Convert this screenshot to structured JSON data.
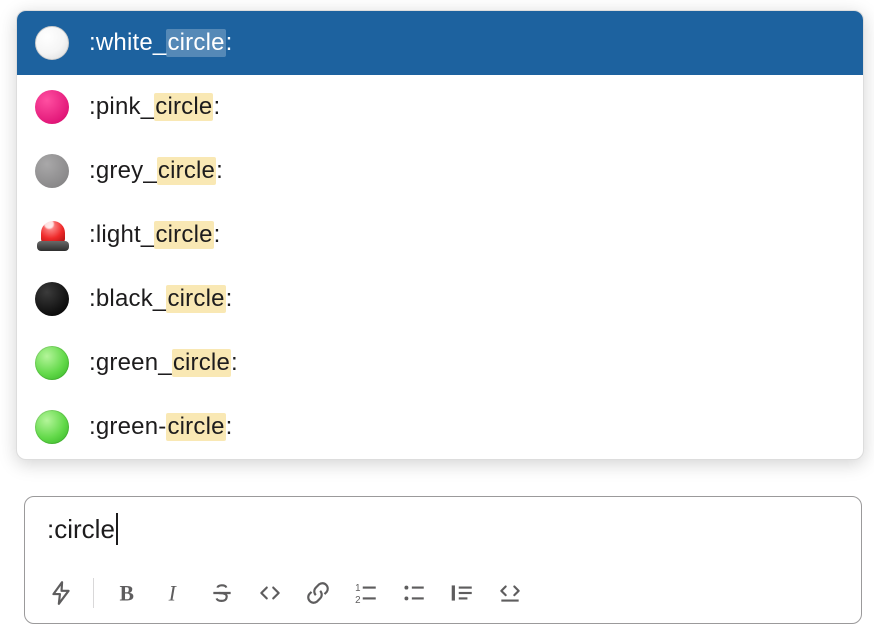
{
  "search_query": "circle",
  "emoji_picker": {
    "selected_index": 0,
    "items": [
      {
        "name": "white_circle",
        "prefix": ":white_",
        "match": "circle",
        "suffix": ":",
        "icon": "white-circle"
      },
      {
        "name": "pink_circle",
        "prefix": ":pink_",
        "match": "circle",
        "suffix": ":",
        "icon": "pink-circle"
      },
      {
        "name": "grey_circle",
        "prefix": ":grey_",
        "match": "circle",
        "suffix": ":",
        "icon": "grey-circle"
      },
      {
        "name": "light_circle",
        "prefix": ":light_",
        "match": "circle",
        "suffix": ":",
        "icon": "siren"
      },
      {
        "name": "black_circle",
        "prefix": ":black_",
        "match": "circle",
        "suffix": ":",
        "icon": "black-circle"
      },
      {
        "name": "green_circle",
        "prefix": ":green_",
        "match": "circle",
        "suffix": ":",
        "icon": "green-circle"
      },
      {
        "name": "green-circle",
        "prefix": ":green-",
        "match": "circle",
        "suffix": ":",
        "icon": "green-circle"
      }
    ]
  },
  "composer": {
    "text_prefix": ":",
    "text_typed": "circle"
  },
  "toolbar": {
    "shortcut": "shortcuts",
    "bold": "B",
    "italic": "I",
    "strike": "strikethrough",
    "code": "code",
    "link": "link",
    "ordered": "ordered-list",
    "bulleted": "bulleted-list",
    "quote": "blockquote",
    "codeblock": "code-block"
  },
  "colors": {
    "selection_bg": "#1d629f",
    "highlight_bg": "#f8e5ac",
    "border": "#9b9a9b"
  }
}
